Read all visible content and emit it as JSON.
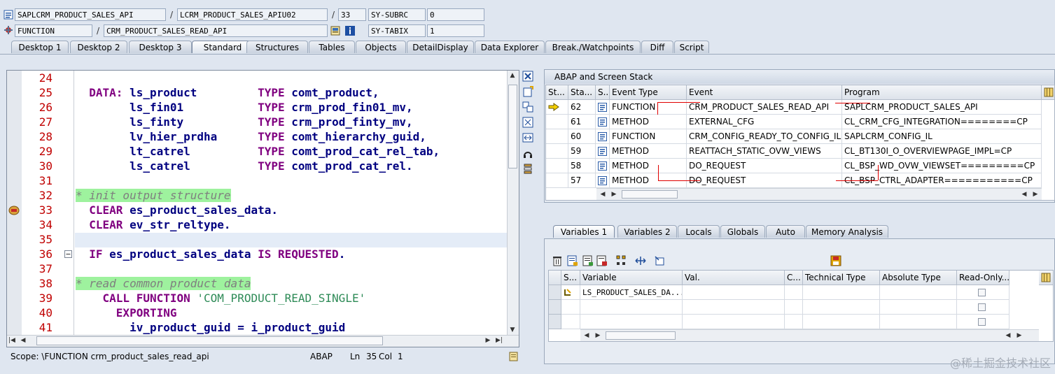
{
  "header": {
    "row1": {
      "program": "SAPLCRM_PRODUCT_SALES_API",
      "include": "LCRM_PRODUCT_SALES_APIU02",
      "line": "33",
      "sysvar": "SY-SUBRC",
      "sysval": "0"
    },
    "row2": {
      "type": "FUNCTION",
      "name": "CRM_PRODUCT_SALES_READ_API",
      "sysvar": "SY-TABIX",
      "sysval": "1"
    },
    "separator": "/"
  },
  "tabs": [
    "Desktop 1",
    "Desktop 2",
    "Desktop 3",
    "Standard",
    "Structures",
    "Tables",
    "Objects",
    "DetailDisplay",
    "Data Explorer",
    "Break./Watchpoints",
    "Diff",
    "Script"
  ],
  "active_tab": "Standard",
  "editor": {
    "lines": [
      {
        "n": "24",
        "segs": []
      },
      {
        "n": "25",
        "segs": [
          {
            "t": "  DATA: ",
            "c": "kw"
          },
          {
            "t": "ls_product         ",
            "c": ""
          },
          {
            "t": "TYPE ",
            "c": "kw"
          },
          {
            "t": "comt_product,",
            "c": ""
          }
        ]
      },
      {
        "n": "26",
        "segs": [
          {
            "t": "        ls_fin01           ",
            "c": ""
          },
          {
            "t": "TYPE ",
            "c": "kw"
          },
          {
            "t": "crm_prod_fin01_mv,",
            "c": ""
          }
        ]
      },
      {
        "n": "27",
        "segs": [
          {
            "t": "        ls_finty           ",
            "c": ""
          },
          {
            "t": "TYPE ",
            "c": "kw"
          },
          {
            "t": "crm_prod_finty_mv,",
            "c": ""
          }
        ]
      },
      {
        "n": "28",
        "segs": [
          {
            "t": "        lv_hier_prdha      ",
            "c": ""
          },
          {
            "t": "TYPE ",
            "c": "kw"
          },
          {
            "t": "comt_hierarchy_guid,",
            "c": ""
          }
        ]
      },
      {
        "n": "29",
        "segs": [
          {
            "t": "        lt_catrel          ",
            "c": ""
          },
          {
            "t": "TYPE ",
            "c": "kw"
          },
          {
            "t": "comt_prod_cat_rel_tab,",
            "c": ""
          }
        ]
      },
      {
        "n": "30",
        "segs": [
          {
            "t": "        ls_catrel          ",
            "c": ""
          },
          {
            "t": "TYPE ",
            "c": "kw"
          },
          {
            "t": "comt_prod_cat_rel.",
            "c": ""
          }
        ]
      },
      {
        "n": "31",
        "segs": []
      },
      {
        "n": "32",
        "segs": [
          {
            "t": "* init output structure",
            "c": "cmt"
          }
        ]
      },
      {
        "n": "33",
        "segs": [
          {
            "t": "  CLEAR ",
            "c": "kw"
          },
          {
            "t": "es_product_sales_data.",
            "c": ""
          }
        ]
      },
      {
        "n": "34",
        "segs": [
          {
            "t": "  CLEAR ",
            "c": "kw"
          },
          {
            "t": "ev_str_reltype.",
            "c": ""
          }
        ]
      },
      {
        "n": "35",
        "segs": []
      },
      {
        "n": "36",
        "segs": [
          {
            "t": "  IF ",
            "c": "kw"
          },
          {
            "t": "es_product_sales_data ",
            "c": ""
          },
          {
            "t": "IS REQUESTED",
            "c": "kw"
          },
          {
            "t": ".",
            "c": ""
          }
        ]
      },
      {
        "n": "37",
        "segs": []
      },
      {
        "n": "38",
        "segs": [
          {
            "t": "* read common product data",
            "c": "cmt"
          }
        ]
      },
      {
        "n": "39",
        "segs": [
          {
            "t": "    CALL FUNCTION ",
            "c": "kw"
          },
          {
            "t": "'COM_PRODUCT_READ_SINGLE'",
            "c": "str"
          }
        ]
      },
      {
        "n": "40",
        "segs": [
          {
            "t": "      EXPORTING",
            "c": "kw"
          }
        ]
      },
      {
        "n": "41",
        "segs": [
          {
            "t": "        iv_product_guid = i_product_guid",
            "c": ""
          }
        ]
      }
    ]
  },
  "status": {
    "scope": "Scope: \\FUNCTION crm_product_sales_read_api",
    "lang": "ABAP",
    "ln_label": "Ln",
    "ln": "35",
    "col_label": "Col",
    "col": "1"
  },
  "stack": {
    "title": "ABAP and Screen Stack",
    "headers": [
      "St...",
      "Sta...",
      "S...",
      "Event Type",
      "Event",
      "Program"
    ],
    "rows": [
      {
        "level": "62",
        "type": "FUNCTION",
        "event": "CRM_PRODUCT_SALES_READ_API",
        "program": "SAPLCRM_PRODUCT_SALES_API",
        "current": true
      },
      {
        "level": "61",
        "type": "METHOD",
        "event": "EXTERNAL_CFG",
        "program": "CL_CRM_CFG_INTEGRATION========CP",
        "current": false
      },
      {
        "level": "60",
        "type": "FUNCTION",
        "event": "CRM_CONFIG_READY_TO_CONFIG_IL",
        "program": "SAPLCRM_CONFIG_IL",
        "current": false
      },
      {
        "level": "59",
        "type": "METHOD",
        "event": "REATTACH_STATIC_OVW_VIEWS",
        "program": "CL_BT130I_O_OVERVIEWPAGE_IMPL=CP",
        "current": false
      },
      {
        "level": "58",
        "type": "METHOD",
        "event": "DO_REQUEST",
        "program": "CL_BSP_WD_OVW_VIEWSET=========CP",
        "current": false
      },
      {
        "level": "57",
        "type": "METHOD",
        "event": "DO_REQUEST",
        "program": "CL_BSP_CTRL_ADAPTER===========CP",
        "current": false
      }
    ]
  },
  "vartabs": [
    "Variables 1",
    "Variables 2",
    "Locals",
    "Globals",
    "Auto",
    "Memory Analysis"
  ],
  "active_vartab": "Variables 1",
  "vars": {
    "headers": [
      "S...",
      "Variable",
      "Val.",
      "C...",
      "Technical Type",
      "Absolute Type",
      "Read-Only..."
    ],
    "rows": [
      {
        "variable": "LS_PRODUCT_SALES_DA..."
      },
      {
        "variable": ""
      },
      {
        "variable": ""
      }
    ]
  },
  "watermark": "@稀土掘金技术社区",
  "colors": {
    "linenum": "#c00000",
    "keyword": "#800080",
    "ident": "#000080",
    "comment_bg": "#9ef29e"
  }
}
